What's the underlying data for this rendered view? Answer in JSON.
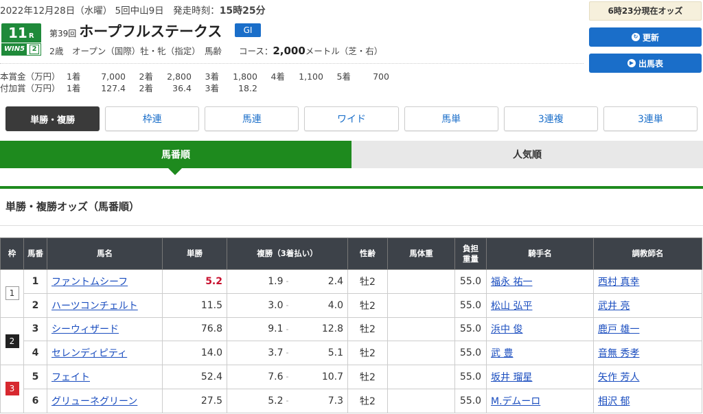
{
  "header": {
    "date_line": "2022年12月28日（水曜） 5回中山9日　発走時刻：",
    "post_time": "15時25分",
    "odds_time": "6時23分現在オッズ",
    "refresh_label": "更新",
    "card_label": "出馬表",
    "race_number": "11",
    "race_unit": "R",
    "wins_label": "WIN5",
    "wins_num": "2",
    "kai": "第39回",
    "race_name": "ホープフルステークス",
    "grade": "GⅠ",
    "conditions": "2歳　オープン（国際）牡・牝（指定）　馬齢　　コース：",
    "distance": "2,000",
    "course_rest": "メートル（芝・右）"
  },
  "prize": {
    "main_label": "本賞金（万円）",
    "main": [
      {
        "place": "1着",
        "amt": "7,000"
      },
      {
        "place": "2着",
        "amt": "2,800"
      },
      {
        "place": "3着",
        "amt": "1,800"
      },
      {
        "place": "4着",
        "amt": "1,100"
      },
      {
        "place": "5着",
        "amt": "700"
      }
    ],
    "add_label": "付加賞（万円）",
    "add": [
      {
        "place": "1着",
        "amt": "127.4"
      },
      {
        "place": "2着",
        "amt": "36.4"
      },
      {
        "place": "3着",
        "amt": "18.2"
      }
    ]
  },
  "tabs": [
    "単勝・複勝",
    "枠連",
    "馬連",
    "ワイド",
    "馬単",
    "3連複",
    "3連単"
  ],
  "order_tabs": [
    "馬番順",
    "人気順"
  ],
  "section_title": "単勝・複勝オッズ（馬番順）",
  "table": {
    "headers": {
      "waku": "枠",
      "umaban": "馬番",
      "name": "馬名",
      "win": "単勝",
      "place": "複勝（3着払い）",
      "sexage": "性齢",
      "weight": "馬体重",
      "burden_1": "負担",
      "burden_2": "重量",
      "jockey": "騎手名",
      "trainer": "調教師名"
    },
    "rows": [
      {
        "waku": "1",
        "num": "1",
        "name": "ファントムシーフ",
        "win": "5.2",
        "p_lo": "1.9",
        "p_hi": "2.4",
        "sexage": "牡2",
        "weight": "",
        "burden": "55.0",
        "jockey": "福永 祐一",
        "trainer": "西村 真幸"
      },
      {
        "waku": "",
        "num": "2",
        "name": "ハーツコンチェルト",
        "win": "11.5",
        "p_lo": "3.0",
        "p_hi": "4.0",
        "sexage": "牡2",
        "weight": "",
        "burden": "55.0",
        "jockey": "松山 弘平",
        "trainer": "武井 亮"
      },
      {
        "waku": "2",
        "num": "3",
        "name": "シーウィザード",
        "win": "76.8",
        "p_lo": "9.1",
        "p_hi": "12.8",
        "sexage": "牡2",
        "weight": "",
        "burden": "55.0",
        "jockey": "浜中 俊",
        "trainer": "鹿戸 雄一"
      },
      {
        "waku": "",
        "num": "4",
        "name": "セレンディピティ",
        "win": "14.0",
        "p_lo": "3.7",
        "p_hi": "5.1",
        "sexage": "牡2",
        "weight": "",
        "burden": "55.0",
        "jockey": "武 豊",
        "trainer": "音無 秀孝"
      },
      {
        "waku": "3",
        "num": "5",
        "name": "フェイト",
        "win": "52.4",
        "p_lo": "7.6",
        "p_hi": "10.7",
        "sexage": "牡2",
        "weight": "",
        "burden": "55.0",
        "jockey": "坂井 瑠星",
        "trainer": "矢作 芳人"
      },
      {
        "waku": "",
        "num": "6",
        "name": "グリューネグリーン",
        "win": "27.5",
        "p_lo": "5.2",
        "p_hi": "7.3",
        "sexage": "牡2",
        "weight": "",
        "burden": "55.0",
        "jockey": "M.デムーロ",
        "trainer": "相沢 郁"
      }
    ]
  },
  "colors": {
    "green": "#1e8a1e",
    "blue": "#1a6ec9",
    "fav": "#c8102e",
    "waku2": "#222222",
    "waku3": "#d7282f"
  }
}
